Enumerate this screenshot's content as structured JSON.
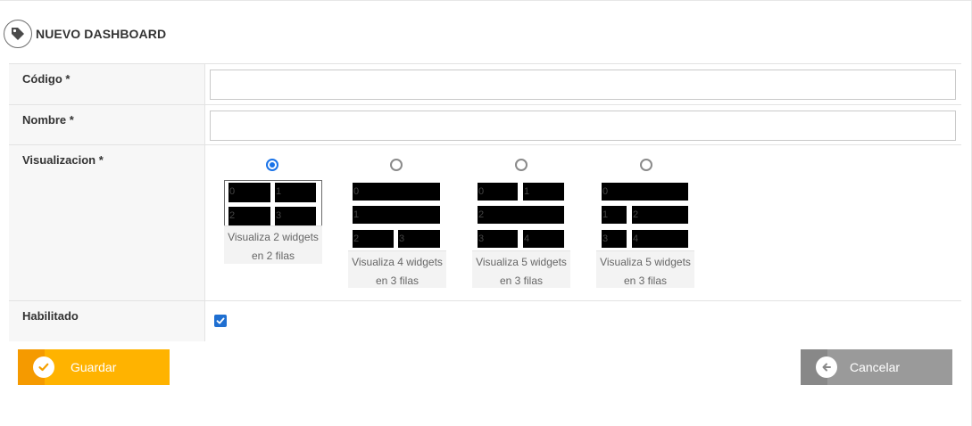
{
  "header": {
    "title": "NUEVO DASHBOARD",
    "icon": "tag-icon"
  },
  "form": {
    "codigo": {
      "label": "Código *",
      "value": "",
      "placeholder": ""
    },
    "nombre": {
      "label": "Nombre *",
      "value": "",
      "placeholder": ""
    },
    "visualizacion": {
      "label": "Visualizacion *",
      "selected_index": 0,
      "options": [
        {
          "caption_line1": "Visualiza 2 widgets",
          "caption_line2": "en 2 filas",
          "layout": [
            [
              "0",
              "1"
            ],
            [
              "2",
              "3"
            ]
          ]
        },
        {
          "caption_line1": "Visualiza 4 widgets",
          "caption_line2": "en 3 filas",
          "layout": [
            [
              "0"
            ],
            [
              "1"
            ],
            [
              "2",
              "3"
            ]
          ]
        },
        {
          "caption_line1": "Visualiza 5 widgets",
          "caption_line2": "en 3 filas",
          "layout": [
            [
              "0",
              "1"
            ],
            [
              "2"
            ],
            [
              "3",
              "4"
            ]
          ]
        },
        {
          "caption_line1": "Visualiza 5 widgets",
          "caption_line2": "en 3 filas",
          "layout": [
            [
              "0"
            ],
            [
              "1",
              "2"
            ],
            [
              "3",
              "4"
            ]
          ]
        }
      ]
    },
    "habilitado": {
      "label": "Habilitado",
      "checked": true
    }
  },
  "actions": {
    "save_label": "Guardar",
    "save_icon": "check-icon",
    "save_color": "#ffb300",
    "cancel_label": "Cancelar",
    "cancel_icon": "arrow-left-icon",
    "cancel_color": "#9a9a9a"
  },
  "colors": {
    "accent": "#1a73e8"
  }
}
